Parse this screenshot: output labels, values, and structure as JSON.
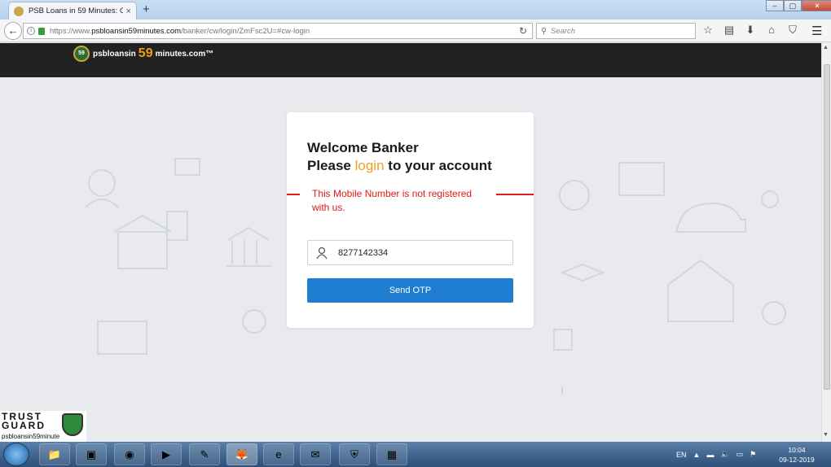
{
  "browser": {
    "tab_title": "PSB Loans in 59 Minutes: O...",
    "tab_close": "×",
    "new_tab": "+",
    "url_prefix": "https://www.",
    "url_domain": "psbloansin59minutes.com",
    "url_path": "/banker/cw/login/ZmFsc2U=#cw-login",
    "search_placeholder": "Search",
    "window_controls": [
      "–",
      "▢",
      "×"
    ]
  },
  "site": {
    "logo_badge": "59",
    "logo_pre": "psbloansin",
    "logo_num": "59",
    "logo_post": "minutes.com™"
  },
  "login": {
    "heading_line1": "Welcome Banker",
    "heading_please": "Please",
    "heading_login": "login",
    "heading_rest": "to your account",
    "error_message": "This Mobile Number is not registered with us.",
    "mobile_value": "8277142334",
    "send_otp": "Send OTP"
  },
  "trustguard": {
    "line1": "TRUST",
    "line2": "GUARD",
    "sub": "psbloansin59minute"
  },
  "taskbar": {
    "lang": "EN",
    "time": "10:04",
    "date": "09-12-2019"
  },
  "colors": {
    "accent": "#f0a020",
    "error": "#e01919",
    "button": "#1f7ed0",
    "header": "#222222"
  }
}
